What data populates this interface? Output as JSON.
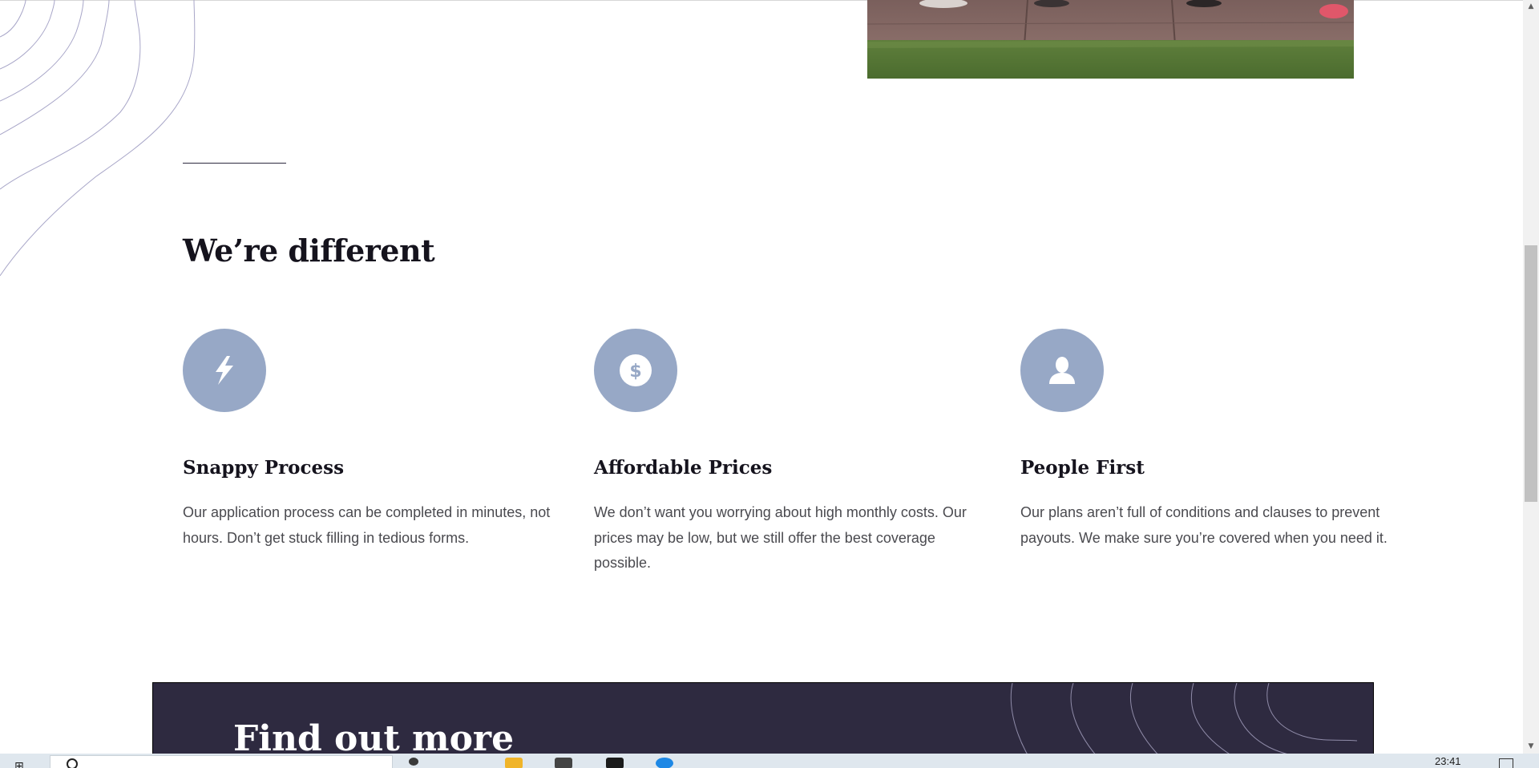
{
  "section": {
    "title": "We’re different"
  },
  "features": [
    {
      "icon": "lightning-bolt-icon",
      "title": "Snappy Process",
      "text": "Our application process can be completed in minutes, not hours. Don’t get stuck filling in tedious forms."
    },
    {
      "icon": "dollar-coin-icon",
      "title": "Affordable Prices",
      "text": "We don’t want you worrying about high monthly costs. Our prices may be low, but we still offer the best coverage possible."
    },
    {
      "icon": "user-icon",
      "title": "People First",
      "text": "Our plans aren’t full of conditions and clauses to prevent payouts. We make sure you’re covered when you need it."
    }
  ],
  "cta": {
    "title": "Find out more"
  },
  "taskbar": {
    "time": "23:41"
  },
  "colors": {
    "icon_circle": "#97a8c6",
    "banner_bg": "#2e2a40",
    "heading": "#15131d",
    "body_text": "#4a4a4f"
  }
}
